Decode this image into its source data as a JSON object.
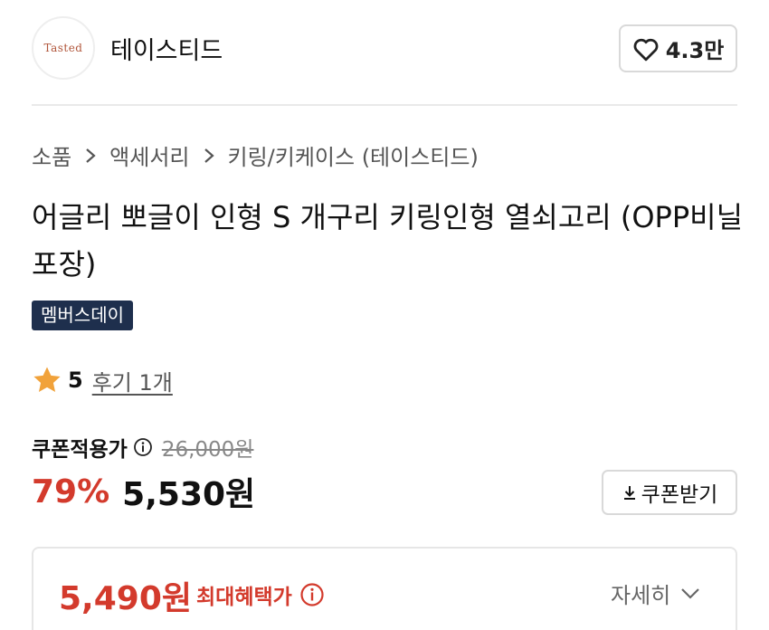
{
  "store": {
    "logo_text": "Tasted",
    "name": "테이스티드",
    "like_count": "4.3만"
  },
  "breadcrumb": {
    "items": [
      "소품",
      "액세서리",
      "키링/키케이스 (테이스티드)"
    ]
  },
  "product": {
    "title": "어글리 뽀글이 인형 S 개구리 키링인형 열쇠고리 (OPP비닐 포장)",
    "badge": "멤버스데이",
    "rating": "5",
    "review_link": "후기 1개"
  },
  "price": {
    "coupon_label": "쿠폰적용가",
    "original_price": "26,000원",
    "discount_rate": "79%",
    "sale_price": "5,530원",
    "coupon_button": "쿠폰받기"
  },
  "benefit": {
    "max_price": "5,490원",
    "label": "최대혜택가",
    "detail_toggle": "자세히"
  },
  "colors": {
    "accent_red": "#d33a2c",
    "badge_navy": "#1e2f4d",
    "star": "#f1a23a"
  }
}
